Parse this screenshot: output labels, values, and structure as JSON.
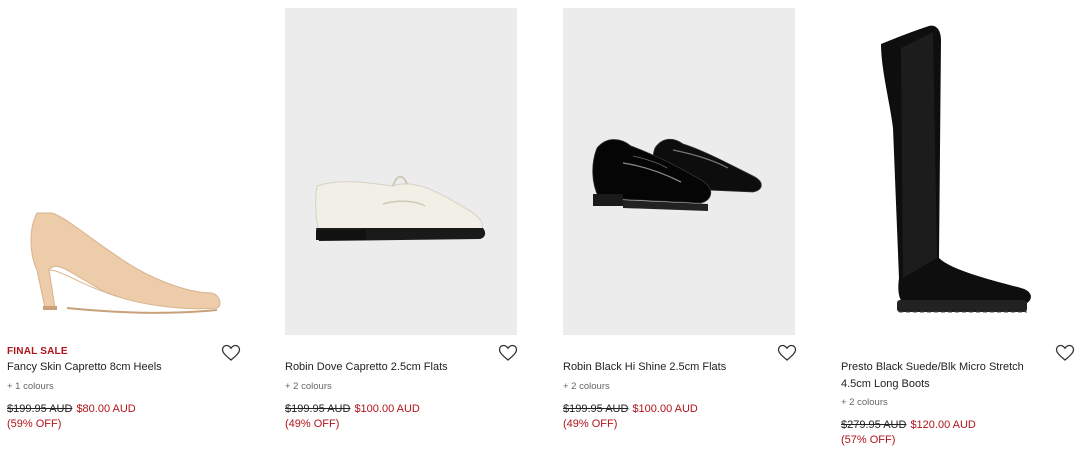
{
  "products": [
    {
      "badge": "FINAL SALE",
      "name": "Fancy Skin Capretto 8cm Heels",
      "colours": "+ 1 colours",
      "old_price": "$199.95 AUD",
      "new_price": "$80.00 AUD",
      "discount": "(59% OFF)",
      "color": "nude"
    },
    {
      "name": "Robin Dove Capretto 2.5cm Flats",
      "colours": "+ 2 colours",
      "old_price": "$199.95 AUD",
      "new_price": "$100.00 AUD",
      "discount": "(49% OFF)",
      "color": "white"
    },
    {
      "name": "Robin Black Hi Shine 2.5cm Flats",
      "colours": "+ 2 colours",
      "old_price": "$199.95 AUD",
      "new_price": "$100.00 AUD",
      "discount": "(49% OFF)",
      "color": "black"
    },
    {
      "name": "Presto Black Suede/Blk Micro Stretch 4.5cm Long Boots",
      "colours": "+ 2 colours",
      "old_price": "$279.95 AUD",
      "new_price": "$120.00 AUD",
      "discount": "(57% OFF)",
      "color": "black"
    }
  ],
  "icons": {
    "wishlist": "heart-outline-icon"
  },
  "colors": {
    "sale_red": "#b0141b",
    "text": "#222222",
    "image_bg": "#ececec"
  }
}
